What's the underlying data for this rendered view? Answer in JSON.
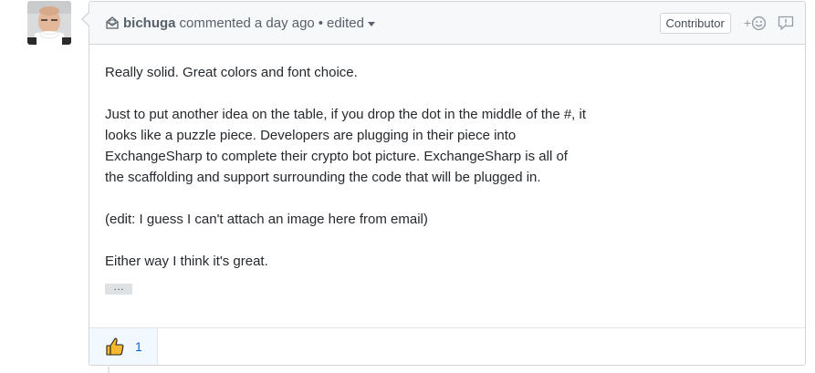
{
  "comment": {
    "author": "bichuga",
    "commented_text": "commented",
    "timestamp": "a day ago",
    "separator": "•",
    "edited_label": "edited",
    "role_badge": "Contributor",
    "add_reaction_label": "+",
    "body": {
      "paragraphs": [
        "Really solid. Great colors and font choice.",
        "Just to put another idea on the table, if you drop the dot in the middle of the #, it looks like a puzzle piece. Developers are plugging in their piece into ExchangeSharp to complete their crypto bot picture. ExchangeSharp is all of the scaffolding and support surrounding the code that will be plugged in.",
        "(edit: I guess I can't attach an image here from email)",
        "Either way I think it's great."
      ],
      "hidden_text_label": "…"
    },
    "reactions": [
      {
        "icon": "thumbs-up-icon",
        "count": "1"
      }
    ]
  },
  "colors": {
    "header_bg": "#f6f8fa",
    "border": "#d1d5da",
    "link_blue": "#0366d6",
    "reaction_bg": "#f1f8ff",
    "text": "#24292e",
    "muted": "#586069"
  }
}
